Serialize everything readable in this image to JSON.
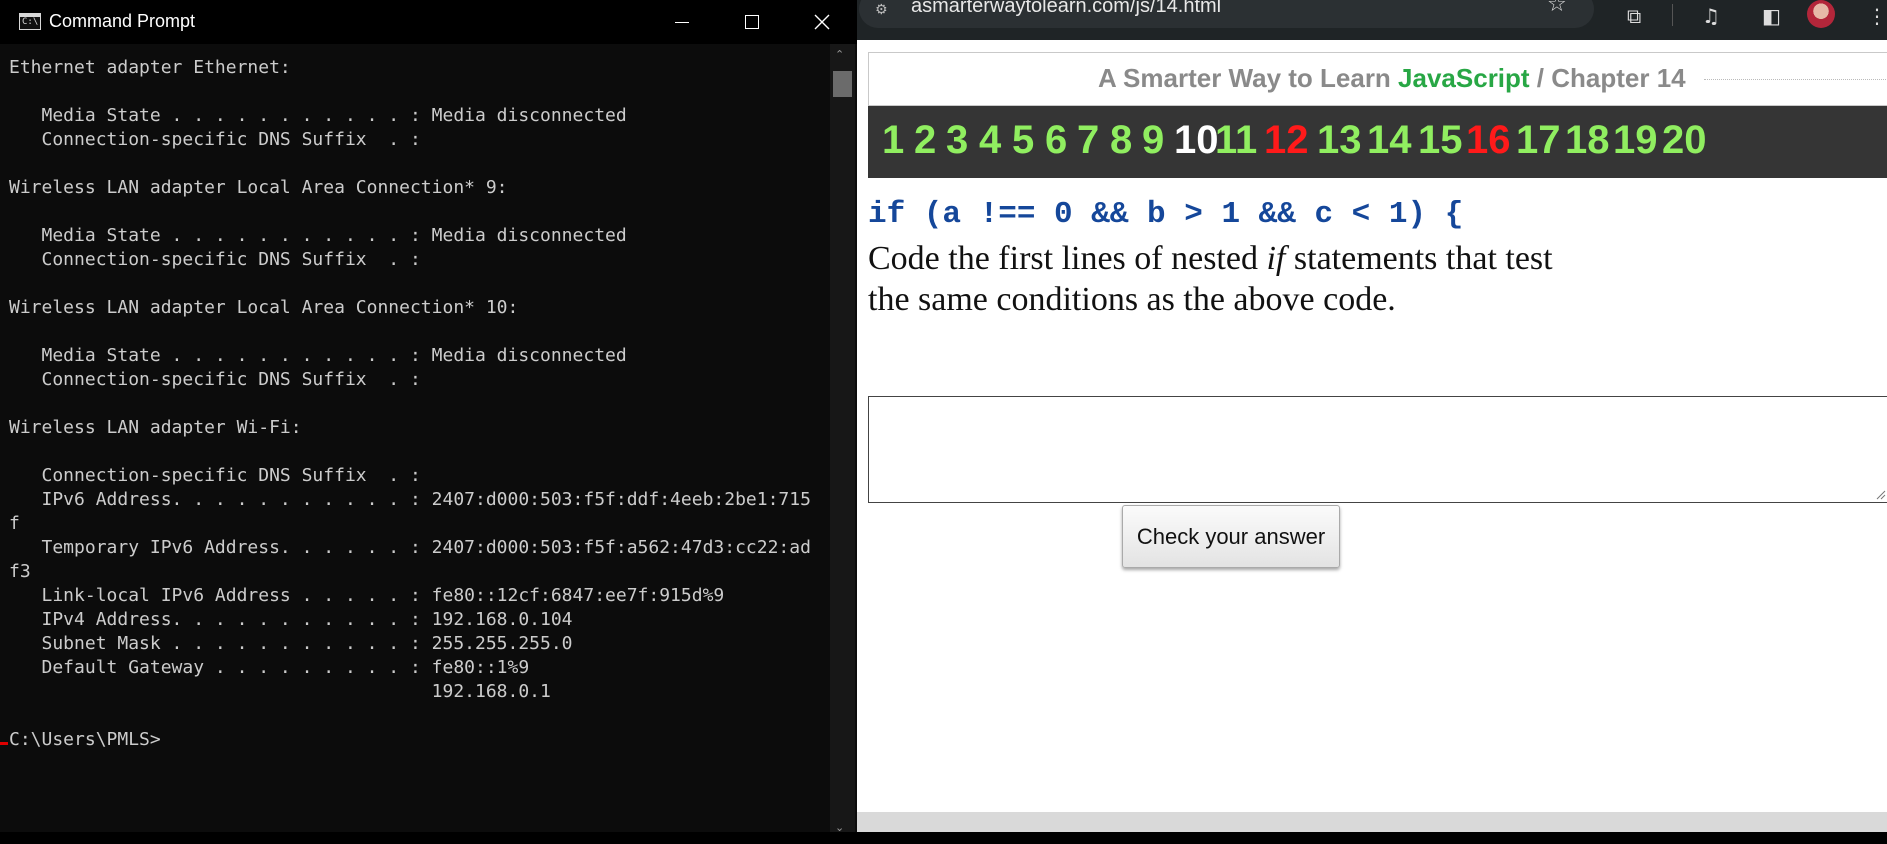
{
  "cmd": {
    "title": "Command Prompt",
    "icon": "cmd-app-icon",
    "output": "Ethernet adapter Ethernet:\n\n   Media State . . . . . . . . . . . : Media disconnected\n   Connection-specific DNS Suffix  . :\n\nWireless LAN adapter Local Area Connection* 9:\n\n   Media State . . . . . . . . . . . : Media disconnected\n   Connection-specific DNS Suffix  . :\n\nWireless LAN adapter Local Area Connection* 10:\n\n   Media State . . . . . . . . . . . : Media disconnected\n   Connection-specific DNS Suffix  . :\n\nWireless LAN adapter Wi-Fi:\n\n   Connection-specific DNS Suffix  . :\n   IPv6 Address. . . . . . . . . . . : 2407:d000:503:f5f:ddf:4eeb:2be1:715\nf\n   Temporary IPv6 Address. . . . . . : 2407:d000:503:f5f:a562:47d3:cc22:ad\nf3\n   Link-local IPv6 Address . . . . . : fe80::12cf:6847:ee7f:915d%9\n   IPv4 Address. . . . . . . . . . . : 192.168.0.104\n   Subnet Mask . . . . . . . . . . . : 255.255.255.0\n   Default Gateway . . . . . . . . . : fe80::1%9\n                                       192.168.0.1\n\nC:\\Users\\PMLS>"
  },
  "browser": {
    "url": "asmarterwaytolearn.com/js/14.html",
    "toolbar_icons": [
      "site-info-icon",
      "star-icon",
      "extensions-icon",
      "media-icon",
      "sidepanel-icon",
      "menu-icon"
    ],
    "header": {
      "prefix": "A Smarter Way to Learn ",
      "brand": "JavaScript",
      "suffix": " / Chapter 14",
      "brand_color": "#28a745"
    },
    "chapters": [
      {
        "label": "1",
        "color": "#90ee60"
      },
      {
        "label": "2",
        "color": "#90ee60"
      },
      {
        "label": "3",
        "color": "#90ee60"
      },
      {
        "label": "4",
        "color": "#90ee60"
      },
      {
        "label": "5",
        "color": "#90ee60"
      },
      {
        "label": "6",
        "color": "#90ee60"
      },
      {
        "label": "7",
        "color": "#90ee60"
      },
      {
        "label": "8",
        "color": "#90ee60"
      },
      {
        "label": "9",
        "color": "#90ee60"
      },
      {
        "label": "10",
        "color": "#ffffff"
      },
      {
        "label": "11",
        "color": "#90ee60"
      },
      {
        "label": "12",
        "color": "#ff1a1a"
      },
      {
        "label": "13",
        "color": "#90ee60"
      },
      {
        "label": "14",
        "color": "#90ee60"
      },
      {
        "label": "15",
        "color": "#90ee60"
      },
      {
        "label": "16",
        "color": "#ff1a1a"
      },
      {
        "label": "17",
        "color": "#90ee60"
      },
      {
        "label": "18",
        "color": "#90ee60"
      },
      {
        "label": "19",
        "color": "#90ee60"
      },
      {
        "label": "20",
        "color": "#90ee60"
      }
    ],
    "code_line": "if (a !== 0 && b > 1 && c < 1) {",
    "instructions": {
      "before": "Code the first lines of nested ",
      "emphasis": "if",
      "after": " statements that test the same conditions as the above code."
    },
    "answer_value": "",
    "check_button_label": "Check your answer",
    "code_color": "#15479a"
  }
}
